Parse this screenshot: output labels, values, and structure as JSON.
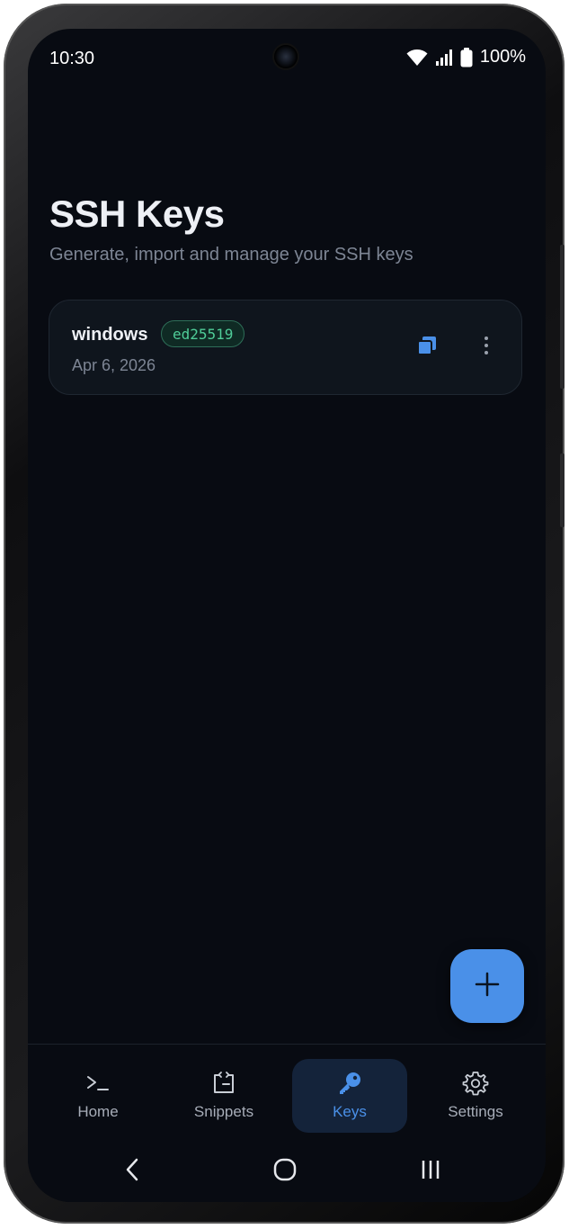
{
  "status_bar": {
    "time": "10:30",
    "battery": "100%"
  },
  "header": {
    "title": "SSH Keys",
    "subtitle": "Generate, import and manage your SSH keys"
  },
  "keys": [
    {
      "name": "windows",
      "type": "ed25519",
      "date": "Apr 6, 2026"
    }
  ],
  "nav": {
    "items": [
      {
        "label": "Home",
        "icon": "terminal-icon"
      },
      {
        "label": "Snippets",
        "icon": "snippet-icon"
      },
      {
        "label": "Keys",
        "icon": "key-icon",
        "active": true
      },
      {
        "label": "Settings",
        "icon": "gear-icon"
      }
    ]
  },
  "colors": {
    "background": "#080b12",
    "accent": "#4a90e8",
    "badge_text": "#4fcc98",
    "card": "#0f151d"
  },
  "icons": [
    "wifi-icon",
    "signal-icon",
    "battery-icon",
    "copy-icon",
    "more-vert-icon",
    "plus-icon",
    "back-icon",
    "home-circle-icon",
    "recents-icon"
  ]
}
